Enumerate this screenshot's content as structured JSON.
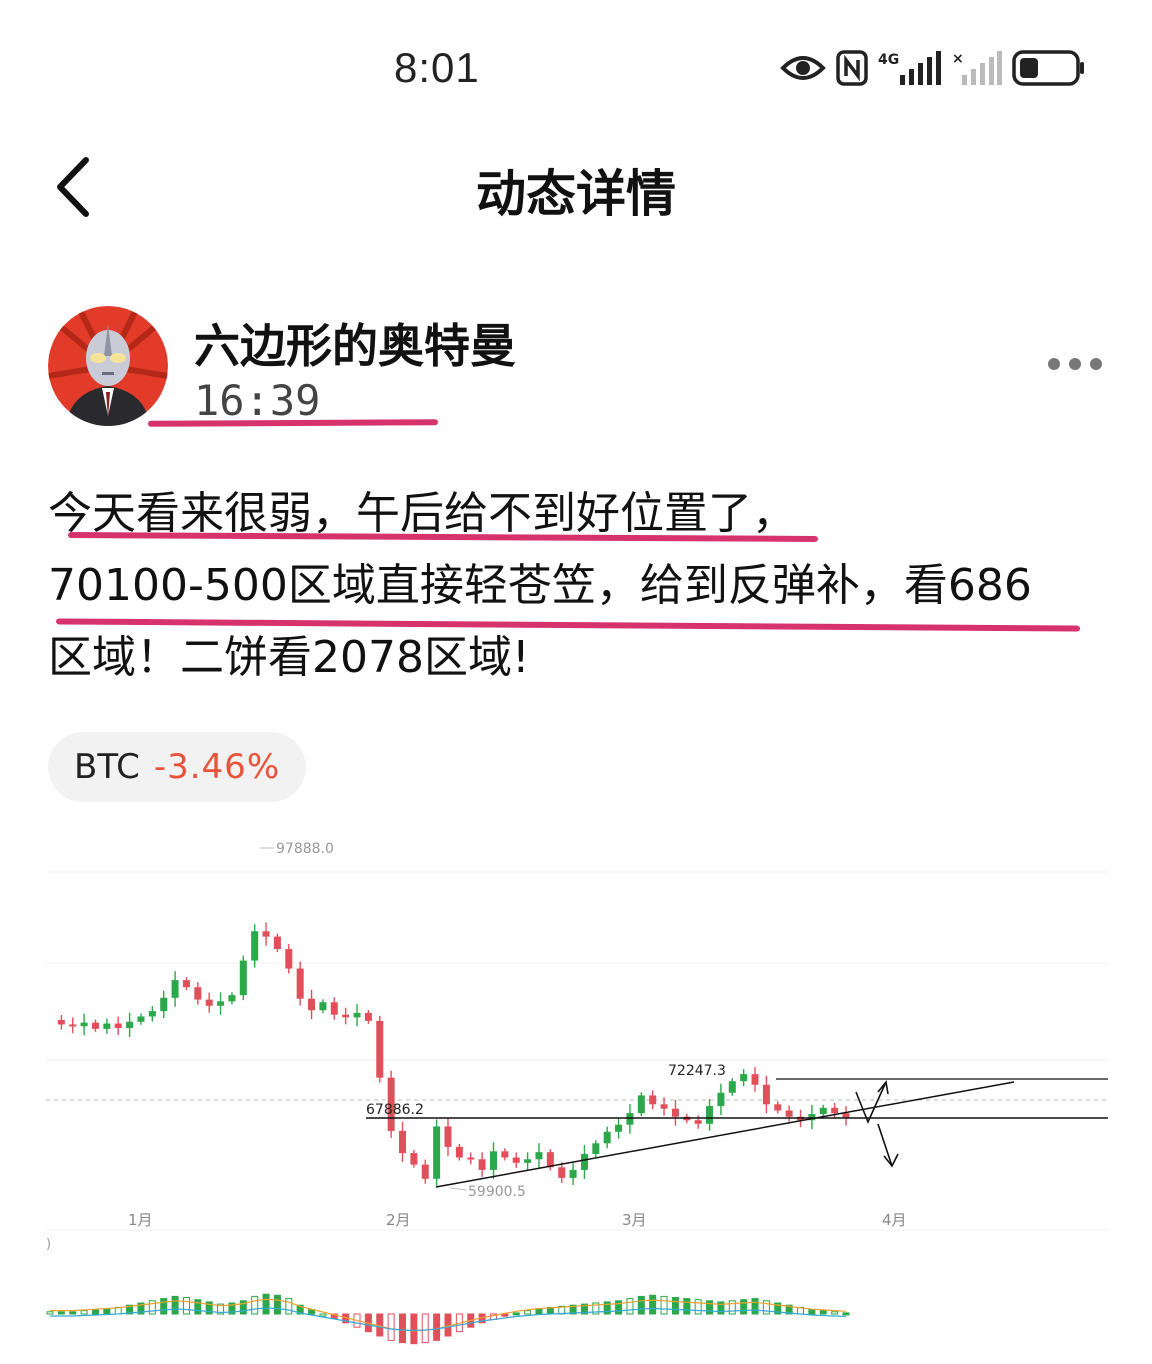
{
  "status_bar": {
    "time": "8:01",
    "icons": [
      "eye-icon",
      "nfc-icon",
      "signal-4g-icon",
      "signal-no-sim-icon",
      "battery-icon"
    ]
  },
  "header": {
    "title": "动态详情",
    "back_icon": "chevron-left-icon"
  },
  "post": {
    "author": "六边形的奥特曼",
    "time": "16:39",
    "lines": [
      "今天看来很弱，午后给不到好位置了，",
      "70100-500区域直接轻苍笠，给到反弹补，看686",
      "区域！二饼看2078区域!"
    ],
    "more_icon": "more-dots-icon"
  },
  "ticker": {
    "symbol": "BTC",
    "change": "-3.46%",
    "change_color": "#e8533a"
  },
  "chart_data": {
    "type": "candlestick",
    "x_labels": [
      "1月",
      "2月",
      "3月",
      "4月"
    ],
    "annotations": [
      "97888.0",
      "72247.3",
      "67886.2",
      "59900.5"
    ],
    "colors": {
      "up": "#2aa84a",
      "down": "#e0505a"
    },
    "price_path": [
      78500,
      78000,
      77800,
      78200,
      77500,
      78100,
      77600,
      78300,
      78900,
      79500,
      81000,
      83000,
      82200,
      80800,
      80100,
      80600,
      81300,
      85200,
      88500,
      87900,
      86500,
      84300,
      80900,
      79600,
      80500,
      79100,
      78800,
      79300,
      78400,
      72000,
      66000,
      63500,
      62200,
      60600,
      66500,
      64200,
      63000,
      62800,
      61600,
      63700,
      63000,
      62400,
      62800,
      63600,
      61900,
      60700,
      61600,
      63400,
      64600,
      65900,
      66700,
      68000,
      70000,
      69000,
      68500,
      67600,
      67200,
      66800,
      68800,
      70300,
      71600,
      72400,
      71200,
      69000,
      68300,
      67600,
      67200,
      67900,
      68600,
      68000,
      67400
    ],
    "macd": [
      0.1,
      0.1,
      0.1,
      0.15,
      0.2,
      0.25,
      0.3,
      0.4,
      0.5,
      0.6,
      0.7,
      0.8,
      0.75,
      0.65,
      0.55,
      0.45,
      0.5,
      0.6,
      0.8,
      0.9,
      0.85,
      0.7,
      0.4,
      0.2,
      0.0,
      -0.2,
      -0.4,
      -0.6,
      -0.8,
      -1.0,
      -1.2,
      -1.3,
      -1.35,
      -1.3,
      -1.2,
      -1.0,
      -0.8,
      -0.6,
      -0.4,
      -0.25,
      -0.1,
      0.05,
      0.15,
      0.25,
      0.3,
      0.35,
      0.4,
      0.45,
      0.5,
      0.55,
      0.6,
      0.7,
      0.8,
      0.85,
      0.8,
      0.75,
      0.7,
      0.65,
      0.6,
      0.55,
      0.6,
      0.65,
      0.7,
      0.6,
      0.5,
      0.4,
      0.3,
      0.2,
      0.15,
      0.1,
      0.05
    ]
  }
}
